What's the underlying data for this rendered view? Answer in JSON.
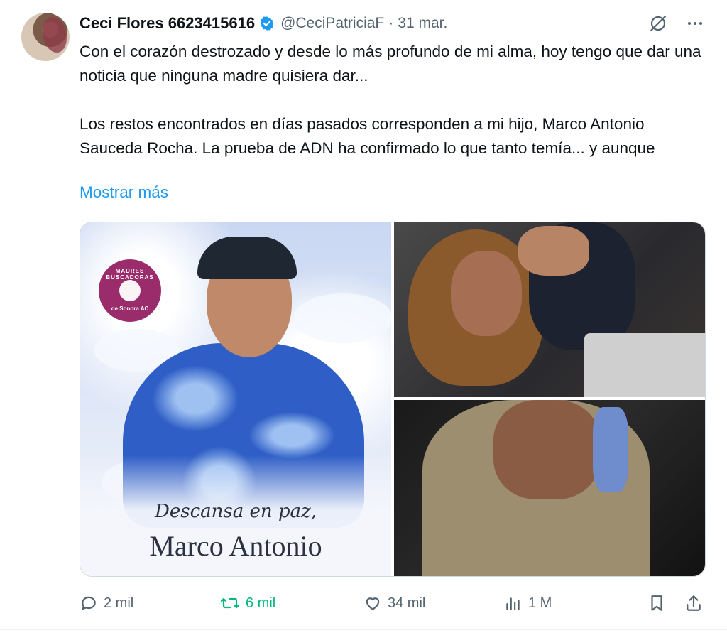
{
  "author": {
    "display_name": "Ceci Flores 6623415616",
    "handle": "@CeciPatriciaF",
    "separator": "·",
    "date": "31 mar."
  },
  "text": {
    "para1": "Con el corazón destrozado y desde lo más profundo de mi alma, hoy tengo que dar una noticia que ninguna madre quisiera dar...",
    "para2": "Los restos encontrados en días pasados corresponden a mi hijo, Marco Antonio Sauceda Rocha. La prueba de ADN ha confirmado lo que tanto temía... y aunque",
    "show_more": "Mostrar más"
  },
  "media": {
    "poster": {
      "logo_top": "MADRES BUSCADORAS",
      "logo_bottom": "de Sonora AC",
      "caption_line1": "Descansa en paz,",
      "caption_line2": "Marco Antonio"
    }
  },
  "actions": {
    "replies": "2 mil",
    "reposts": "6 mil",
    "likes": "34 mil",
    "views": "1 M"
  },
  "icons": {
    "verified": "verified-badge-icon",
    "grok": "grok-icon",
    "more": "more-icon",
    "reply": "reply-icon",
    "repost": "repost-icon",
    "like": "heart-icon",
    "views": "views-icon",
    "bookmark": "bookmark-icon",
    "share": "share-icon"
  },
  "colors": {
    "verified": "#1d9bf0",
    "link": "#1d9bf0",
    "repost_active": "#00ba7c",
    "muted": "#536471",
    "badge": "#9b2c6c"
  }
}
